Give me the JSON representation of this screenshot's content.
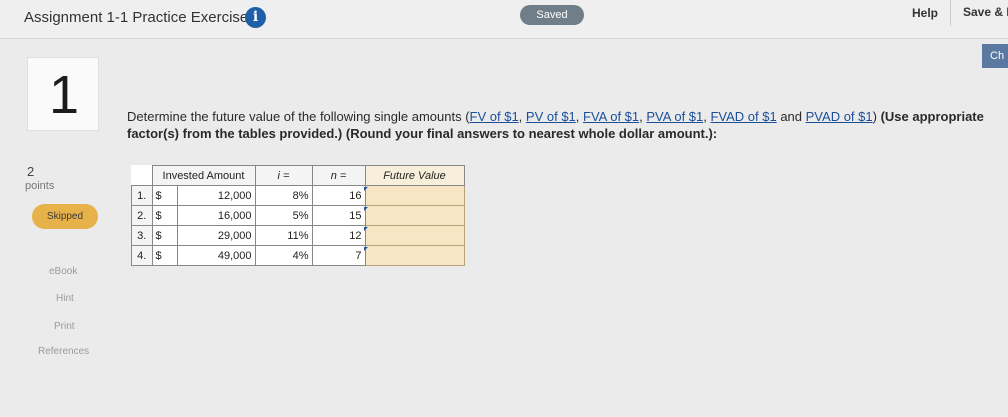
{
  "header": {
    "title": "Assignment 1-1 Practice Exercises",
    "info_icon": "info-icon",
    "saved_label": "Saved",
    "help_label": "Help",
    "save_exit_label": "Save & E",
    "check_label": "Ch"
  },
  "question": {
    "number": "1",
    "points_value": "2",
    "points_label": "points",
    "status": "Skipped",
    "intro": "Determine the future value of the following single amounts (",
    "links": [
      "FV of $1",
      "PV of $1",
      "FVA of $1",
      "PVA of $1",
      "FVAD of $1",
      "PVAD of $1"
    ],
    "instructions": "(Use appropriate factor(s) from the tables provided.) (Round your final answers to nearest whole dollar amount.):"
  },
  "side_links": {
    "ebook": "eBook",
    "hint": "Hint",
    "print": "Print",
    "references": "References"
  },
  "table": {
    "headers": {
      "invested": "Invested Amount",
      "i": "i =",
      "n": "n =",
      "fv": "Future Value"
    },
    "rows": [
      {
        "idx": "1.",
        "dollar": "$",
        "amount": "12,000",
        "i": "8%",
        "n": "16",
        "fv": ""
      },
      {
        "idx": "2.",
        "dollar": "$",
        "amount": "16,000",
        "i": "5%",
        "n": "15",
        "fv": ""
      },
      {
        "idx": "3.",
        "dollar": "$",
        "amount": "29,000",
        "i": "11%",
        "n": "12",
        "fv": ""
      },
      {
        "idx": "4.",
        "dollar": "$",
        "amount": "49,000",
        "i": "4%",
        "n": "7",
        "fv": ""
      }
    ]
  },
  "colors": {
    "accent": "#1f5fa8",
    "skipped": "#e7b24a",
    "answer_cell": "#f6e6c4"
  }
}
